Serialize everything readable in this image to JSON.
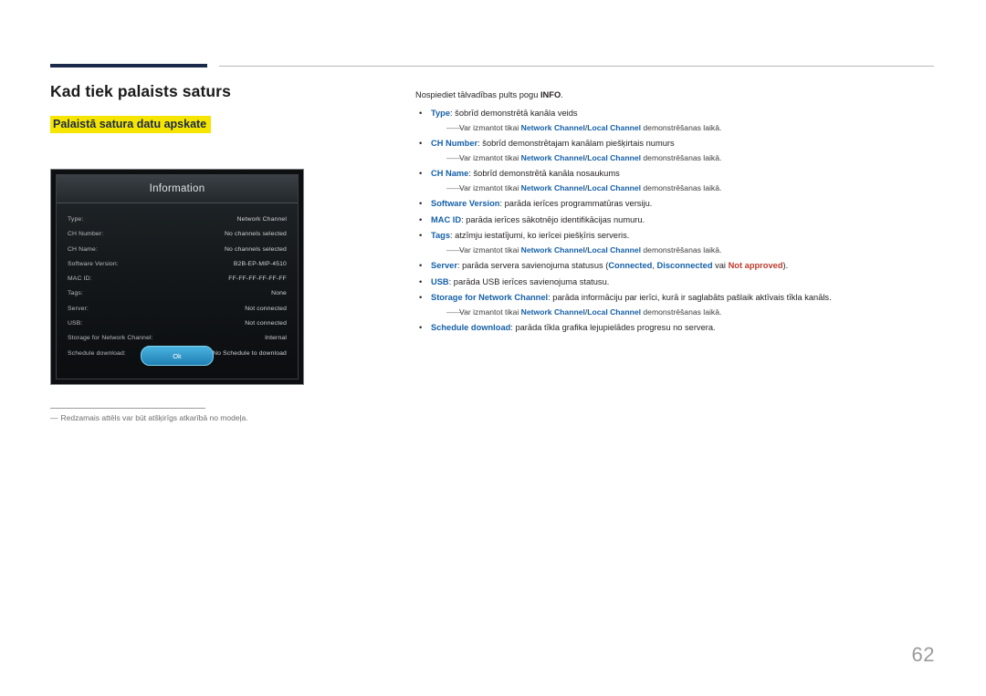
{
  "header": {
    "title": "Kad tiek palaists saturs",
    "subtitle": "Palaistā satura datu apskate"
  },
  "osd": {
    "title": "Information",
    "rows": [
      {
        "label": "Type:",
        "value": "Network Channel"
      },
      {
        "label": "CH Number:",
        "value": "No channels selected"
      },
      {
        "label": "CH Name:",
        "value": "No channels selected"
      },
      {
        "label": "Software Version:",
        "value": "B2B-EP-MIP-4510"
      },
      {
        "label": "MAC ID:",
        "value": "FF-FF-FF-FF-FF-FF"
      },
      {
        "label": "Tags:",
        "value": "None"
      },
      {
        "label": "Server:",
        "value": "Not connected"
      },
      {
        "label": "USB:",
        "value": "Not connected"
      },
      {
        "label": "Storage for Network Channel:",
        "value": "Internal"
      },
      {
        "label": "Schedule download:",
        "value": "No Schedule to download"
      }
    ],
    "ok_label": "Ok"
  },
  "footnote": {
    "dash": "―",
    "text": "Redzamais attēls var būt atšķirīgs atkarībā no modeļa."
  },
  "right": {
    "intro_pre": "Nospiediet tālvadības pults pogu ",
    "intro_bold": "INFO",
    "intro_post": ".",
    "note_dash": "――",
    "note_pre": "Var izmantot tikai ",
    "note_b1": "Network Channel",
    "note_slash": "/",
    "note_b2": "Local Channel",
    "note_post": " demonstrēšanas laikā.",
    "items": [
      {
        "term": "Type",
        "desc": ": šobrīd demonstrētā kanāla veids",
        "note": true
      },
      {
        "term": "CH Number",
        "desc": ": šobrīd demonstrētajam kanālam piešķirtais numurs",
        "note": true
      },
      {
        "term": "CH Name",
        "desc": ": šobrīd demonstrētā kanāla nosaukums",
        "note": true
      },
      {
        "term": "Software Version",
        "desc": ": parāda ierīces programmatūras versiju.",
        "note": false
      },
      {
        "term": "MAC ID",
        "desc": ": parāda ierīces sākotnējo identifikācijas numuru.",
        "note": false
      },
      {
        "term": "Tags",
        "desc": ": atzīmju iestatījumi, ko ierīcei piešķīris serveris.",
        "note": true
      },
      {
        "term": "Server",
        "desc": ": parāda servera savienojuma statusus (",
        "note": false,
        "states": [
          "Connected",
          "Disconnected",
          "Not approved"
        ],
        "state_sep1": ", ",
        "state_sep2": " vai ",
        "desc_end": ")."
      },
      {
        "term": "USB",
        "desc": ": parāda USB ierīces savienojuma statusu.",
        "note": false
      },
      {
        "term": "Storage for Network Channel",
        "desc": ": parāda informāciju par ierīci, kurā ir saglabāts pašlaik aktīvais tīkla kanāls.",
        "note": true
      },
      {
        "term": "Schedule download",
        "desc": ": parāda tīkla grafika lejupielādes progresu no servera.",
        "note": false
      }
    ]
  },
  "page_number": "62",
  "colors": {
    "accent_navy": "#1b2a4a",
    "highlight_yellow": "#f6e500",
    "term_blue": "#1560a8",
    "state_red": "#c0392b"
  }
}
